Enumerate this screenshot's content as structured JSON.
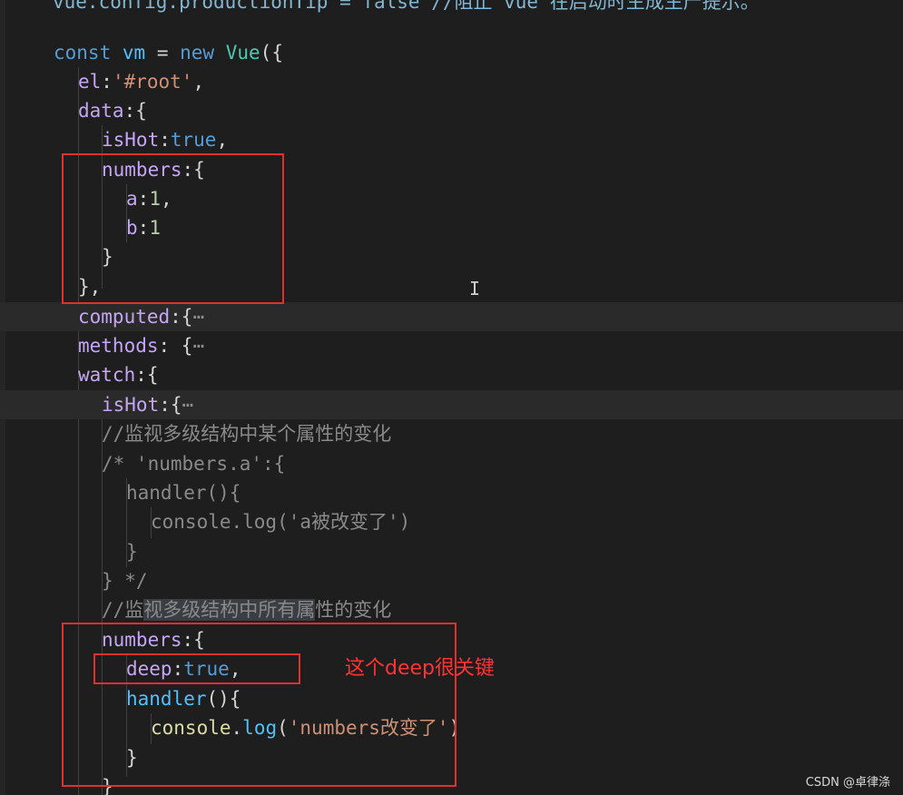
{
  "editor": {
    "top_cutoff": "vue.config.productionTip = false //阻止 vue 在启动时生成生产提示。",
    "lines": {
      "l1": {
        "a": "const",
        "b": "vm",
        "c": "=",
        "d": "new",
        "e": "Vue",
        "f": "({"
      },
      "l2": {
        "a": "el",
        "b": ":",
        "c": "'#root'",
        "d": ","
      },
      "l3": {
        "a": "data",
        "b": ":{"
      },
      "l4": {
        "a": "isHot",
        "b": ":",
        "c": "true",
        "d": ","
      },
      "l5": {
        "a": "numbers",
        "b": ":{"
      },
      "l6": {
        "a": "a",
        "b": ":",
        "c": "1",
        "d": ","
      },
      "l7": {
        "a": "b",
        "b": ":",
        "c": "1"
      },
      "l8": {
        "a": "}"
      },
      "l9": {
        "a": "},"
      },
      "l10": {
        "a": "computed",
        "b": ":{",
        "c": "⋯"
      },
      "l11": {
        "a": "methods",
        "b": ": {",
        "c": "⋯"
      },
      "l12": {
        "a": "watch",
        "b": ":{"
      },
      "l13": {
        "a": "isHot",
        "b": ":{",
        "c": "⋯"
      },
      "l14": {
        "a": "//监视多级结构中某个属性的变化"
      },
      "l15": {
        "a": "/* 'numbers.a':{"
      },
      "l16": {
        "a": "handler(){"
      },
      "l17": {
        "a": "console.log('a被改变了')"
      },
      "l18": {
        "a": "}"
      },
      "l19": {
        "a": "} */"
      },
      "l20": {
        "a": "//监",
        "b": "视多级结构中所有属",
        "c": "性的变化"
      },
      "l21": {
        "a": "numbers",
        "b": ":{"
      },
      "l22": {
        "a": "deep",
        "b": ":",
        "c": "true",
        "d": ","
      },
      "l23": {
        "a": "handler",
        "b": "(){"
      },
      "l24": {
        "a": "console",
        "b": ".",
        "c": "log",
        "d": "(",
        "e": "'numbers改变了'",
        "f": ")"
      },
      "l25": {
        "a": "}"
      },
      "l26": {
        "a": "}"
      }
    }
  },
  "annotation": "这个deep很关键",
  "watermark": "CSDN @卓律涤",
  "colors": {
    "annotation_red": "#e03030",
    "background": "#1e1e1e"
  }
}
